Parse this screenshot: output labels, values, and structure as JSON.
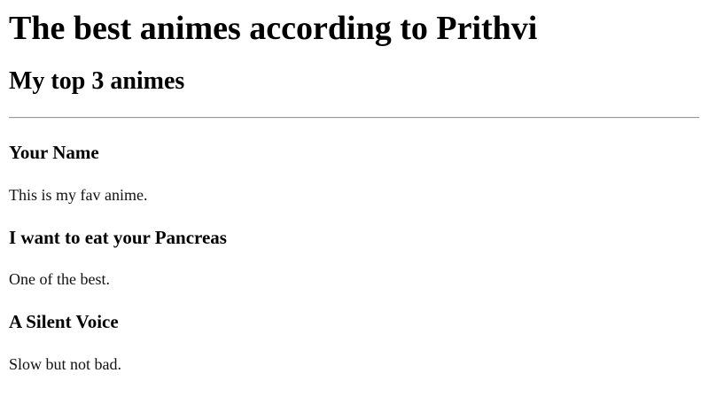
{
  "page": {
    "title": "The best animes according to Prithvi",
    "subtitle": "My top 3 animes",
    "animes": [
      {
        "name": "Your Name",
        "description": "This is my fav anime."
      },
      {
        "name": "I want to eat your Pancreas",
        "description": "One of the best."
      },
      {
        "name": "A Silent Voice",
        "description": "Slow but not bad."
      }
    ]
  }
}
